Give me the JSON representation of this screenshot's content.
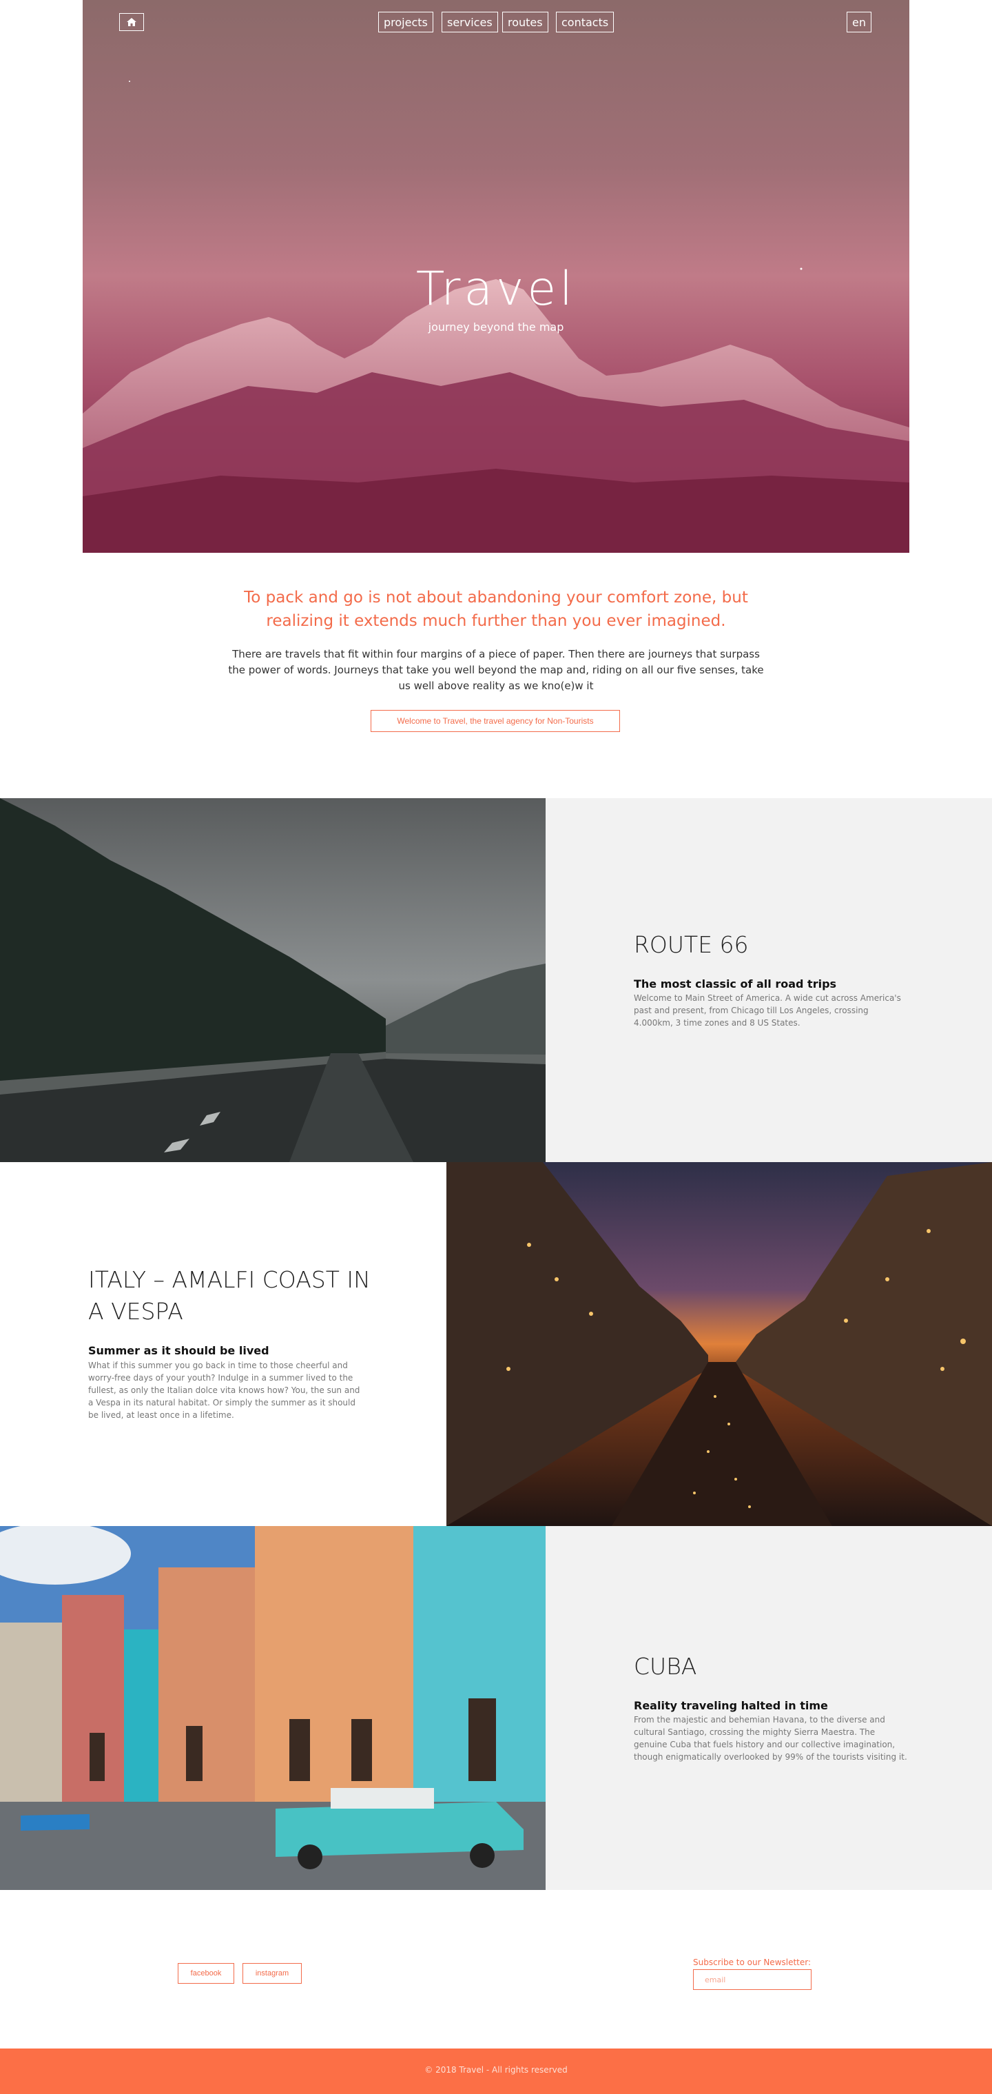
{
  "nav": {
    "home_icon": "home-icon",
    "items": [
      {
        "label": "projects"
      },
      {
        "label": "services"
      },
      {
        "label": "routes"
      },
      {
        "label": "contacts"
      }
    ],
    "language": "en"
  },
  "hero": {
    "title": "Travel",
    "subtitle": "journey beyond the map"
  },
  "intro": {
    "quote": "To pack and go is not about abandoning your comfort zone, but realizing it extends much further than you ever imagined.",
    "text": "There are travels that fit within four margins of a piece of paper. Then there are journeys that surpass the power of words. Journeys that take you well beyond the map and, riding on all our five senses, take us well above reality as we kno(e)w it",
    "button": "Welcome to Travel, the travel agency for Non-Tourists"
  },
  "sections": [
    {
      "title": "ROUTE 66",
      "subtitle": "The most classic of all road trips",
      "text": "Welcome to Main Street of America. A wide cut across America's past and present, from Chicago till Los Angeles, crossing 4.000km, 3 time zones and 8 US States."
    },
    {
      "title": "ITALY – AMALFI COAST IN A VESPA",
      "subtitle": "Summer as it should be lived",
      "text": "What if this summer you go back in time to those cheerful and worry-free days of your youth? Indulge in a summer lived to the fullest, as only the Italian dolce vita knows how? You, the sun and a Vespa in its natural habitat. Or simply the summer as it should be lived, at least once in a lifetime."
    },
    {
      "title": "CUBA",
      "subtitle": "Reality traveling halted in time",
      "text": "From the majestic and behemian Havana, to the diverse and cultural Santiago, crossing the mighty Sierra Maestra. The genuine Cuba that fuels history and our collective imagination, though enigmatically overlooked by 99% of the tourists visiting it."
    }
  ],
  "footer": {
    "social": [
      {
        "label": "facebook"
      },
      {
        "label": "instagram"
      }
    ],
    "newsletter_label": "Subscribe to our Newsletter:",
    "newsletter_placeholder": "email",
    "copyright": "© 2018 Travel - All rights reserved"
  },
  "colors": {
    "accent": "#f36b4a",
    "footer_bg": "#fc6f46",
    "panel_bg": "#f2f2f2"
  }
}
